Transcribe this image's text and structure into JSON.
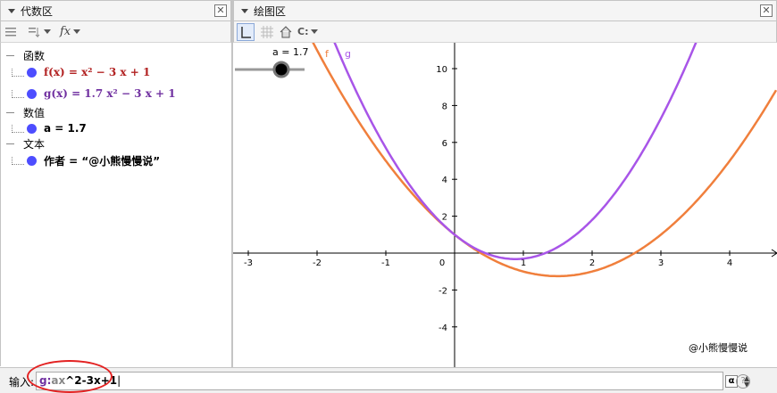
{
  "algebra": {
    "title": "代数区",
    "categories": [
      {
        "label": "函数"
      },
      {
        "label": "数值"
      },
      {
        "label": "文本"
      }
    ],
    "items": {
      "f": {
        "label": "f(x) = x² − 3 x + 1"
      },
      "g": {
        "label": "g(x) = 1.7 x² − 3 x + 1"
      },
      "a": {
        "label": "a = 1.7"
      },
      "text": {
        "label": "作者 = “@小熊慢慢说”"
      }
    },
    "toolbar": {
      "fx_label": "fx"
    }
  },
  "graphics": {
    "title": "绘图区",
    "slider_label": "a = 1.7",
    "curve_labels": {
      "f": "f",
      "g": "g"
    },
    "watermark": "@小熊慢慢说",
    "x_ticks": [
      "-3",
      "-2",
      "-1",
      "0",
      "1",
      "2",
      "3",
      "4"
    ],
    "y_ticks": [
      "10",
      "8",
      "6",
      "4",
      "2",
      "-2",
      "-4"
    ],
    "colors": {
      "f": "#f07f3c",
      "g": "#a855e8",
      "axis": "#000000"
    }
  },
  "input": {
    "label": "输入:",
    "value_name": "g:",
    "value_a": "ax",
    "value_rest": "^2-3x+1",
    "alpha_symbol": "α",
    "help_symbol": "?"
  },
  "chart_data": {
    "type": "line",
    "series": [
      {
        "name": "f",
        "expression": "x^2 - 3x + 1",
        "a": 1
      },
      {
        "name": "g",
        "expression": "1.7x^2 - 3x + 1",
        "a": 1.7
      }
    ],
    "xlim": [
      -3.2,
      4.6
    ],
    "ylim": [
      -5.8,
      10.8
    ],
    "grid": false
  }
}
